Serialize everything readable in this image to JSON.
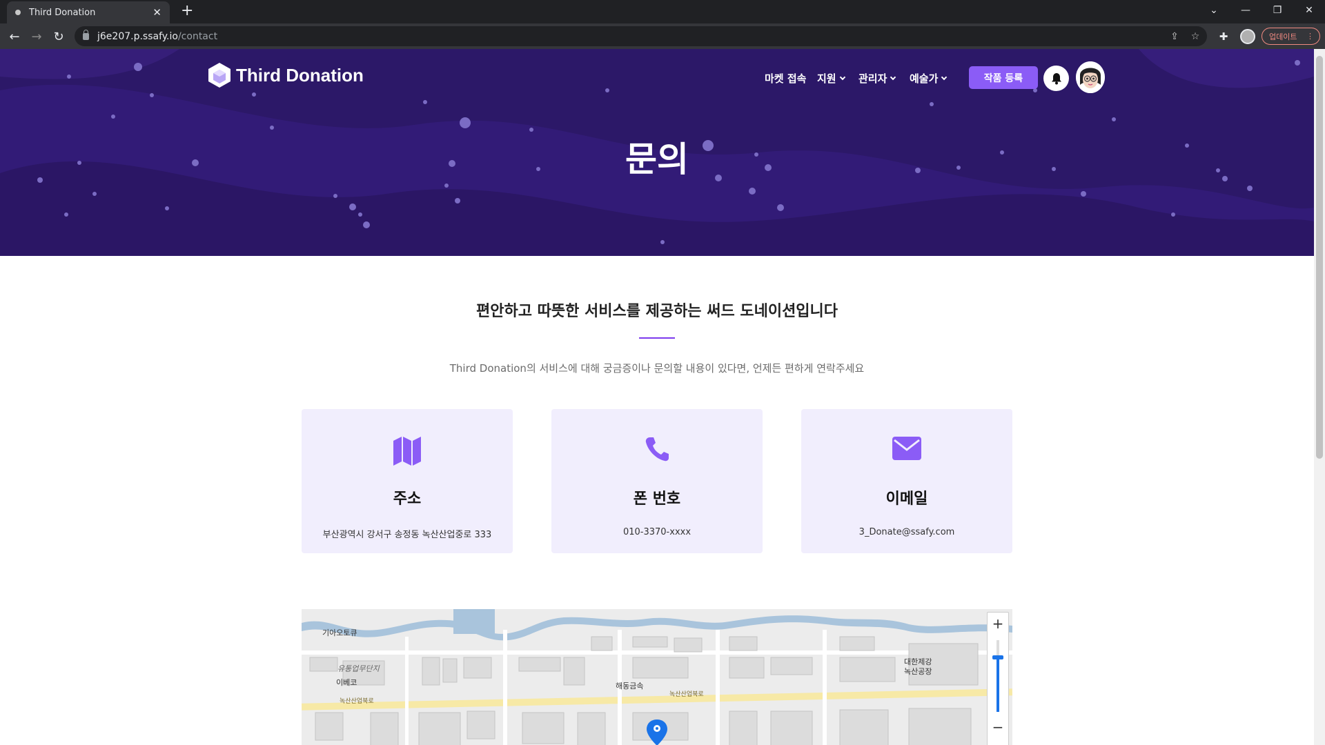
{
  "browser": {
    "tab_title": "Third Donation",
    "url_host": "j6e207.p.ssafy.io",
    "url_path": "/contact",
    "update_label": "업데이트"
  },
  "site": {
    "logo_text": "Third Donation",
    "nav": [
      {
        "label": "마켓 접속",
        "has_dropdown": false
      },
      {
        "label": "지원",
        "has_dropdown": true
      },
      {
        "label": "관리자",
        "has_dropdown": true
      },
      {
        "label": "예술가",
        "has_dropdown": true
      }
    ],
    "register_button": "작품 등록",
    "hero_title": "문의",
    "accent_color": "#8b5cf6",
    "hero_color": "#2c1868"
  },
  "main": {
    "section_title": "편안하고 따뜻한 서비스를 제공하는 써드 도네이션입니다",
    "subtitle": "Third Donation의 서비스에 대해 궁금증이나 문의할 내용이 있다면, 언제든 편하게 연락주세요",
    "cards": [
      {
        "icon": "map-icon",
        "label": "주소",
        "value": "부산광역시 강서구 송정동 녹산산업중로 333"
      },
      {
        "icon": "phone-icon",
        "label": "폰 번호",
        "value": "010-3370-xxxx"
      },
      {
        "icon": "envelope-icon",
        "label": "이메일",
        "value": "3_Donate@ssafy.com"
      }
    ]
  },
  "map": {
    "labels": [
      "기아오토큐",
      "유통업무단지",
      "이베코",
      "해동금속",
      "대한제강",
      "녹산공장"
    ],
    "road_labels": [
      "녹산산업북로",
      "녹산산업북로"
    ],
    "zoom_in": "+",
    "zoom_out": "−"
  }
}
